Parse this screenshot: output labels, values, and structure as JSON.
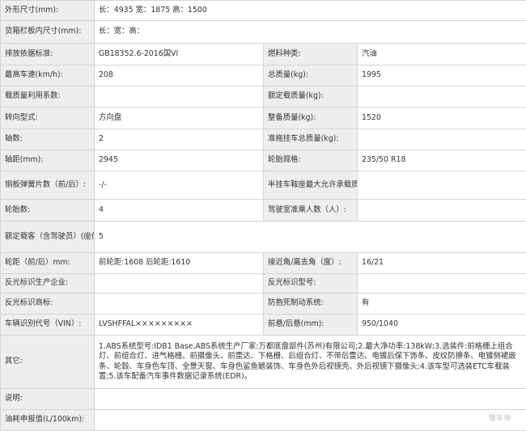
{
  "rows": [
    {
      "label": "外形尺寸(mm):",
      "value": "长：4935 宽：1875 高：1500"
    },
    {
      "label": "货箱栏板内尺寸(mm):",
      "value": "长：宽：高："
    },
    {
      "label": "排放依据标准:",
      "value": "GB18352.6-2016国VI",
      "label2": "燃料种类:",
      "value2": "汽油"
    },
    {
      "label": "最高车速(km/h):",
      "value": "208",
      "label2": "总质量(kg):",
      "value2": "1995"
    },
    {
      "label": "载质量利用系数:",
      "value": "",
      "label2": "额定载质量(kg):",
      "value2": ""
    },
    {
      "label": "转向型式:",
      "value": "方向盘",
      "label2": "整备质量(kg):",
      "value2": "1520"
    },
    {
      "label": "轴数:",
      "value": "2",
      "label2": "准拖挂车总质量(kg):",
      "value2": ""
    },
    {
      "label": "轴距(mm):",
      "value": "2945",
      "label2": "轮胎规格:",
      "value2": "235/50 R18"
    },
    {
      "label": "钢板弹簧片数（前/后）:",
      "value": "-/-",
      "label2": "半挂车鞍座最大允许承载质量(kg):",
      "value2": ""
    },
    {
      "label": "轮胎数:",
      "value": "4",
      "label2": "驾驶室准乘人数（人）:",
      "value2": ""
    },
    {
      "label": "额定载客（含驾驶员）(座位数):",
      "value": "5"
    },
    {
      "label": "轮距（前/后）mm:",
      "value": "前轮距:1608 后轮距:1610",
      "label2": "接近角/离去角（度）:",
      "value2": "16/21"
    },
    {
      "label": "反光标识生产企业:",
      "value": "",
      "label2": "反光标识型号:",
      "value2": ""
    },
    {
      "label": "反光标识商标:",
      "value": "",
      "label2": "防抱死制动系统:",
      "value2": "有"
    },
    {
      "label": "车辆识别代号（VIN）:",
      "value": "LVSHFFAL×××××××××",
      "label2": "前悬/后悬(mm):",
      "value2": "950/1040"
    },
    {
      "label": "其它:",
      "value": "1.ABS系统型号:IDB1 Base,ABS系统生产厂家:万都底盘部件(苏州)有限公司;2.最大净功率:138kW;3.选装件:前格栅上组合灯、前组合灯、进气格栅、前摄像头、前雷达、下格栅、后组合灯、不带后雷达、电镀后保下饰条、皮纹防擦条、电镀侧裙嵌条、轮毂、车身色车顶、全景天窗、车身色鲨鱼鳍装饰、车身色外后视镜壳、外后视镜下摄像头;4.该车型可选装ETC车载装置;5.该车配备汽车事件数据记录系统(EDR)。"
    },
    {
      "label": "说明:",
      "value": ""
    },
    {
      "label": "油耗申报值(L/100km):",
      "value": ""
    }
  ],
  "watermark": "懂车帝"
}
